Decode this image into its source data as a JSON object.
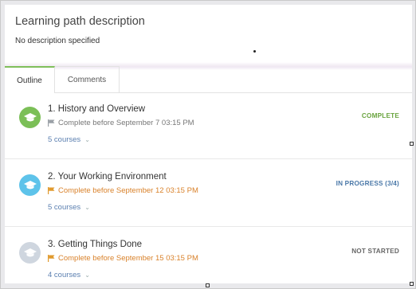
{
  "description": {
    "title": "Learning path description",
    "text": "No description specified"
  },
  "tabs": [
    {
      "label": "Outline",
      "active": true
    },
    {
      "label": "Comments",
      "active": false
    }
  ],
  "items": [
    {
      "title": "1. History and Overview",
      "due": "Complete before September 7 03:15 PM",
      "courses": "5 courses",
      "status": "COMPLETE",
      "badge_color": "#7bbf57",
      "status_color": "#6aa43f",
      "due_color": "#777777",
      "flag_color": "#9aa0a6"
    },
    {
      "title": "2. Your Working Environment",
      "due": "Complete before September 12 03:15 PM",
      "courses": "5 courses",
      "status": "IN PROGRESS (3/4)",
      "badge_color": "#5ec3ea",
      "status_color": "#4a78a8",
      "due_color": "#d9822b",
      "flag_color": "#e09a2e"
    },
    {
      "title": "3. Getting Things Done",
      "due": "Complete before September 15 03:15 PM",
      "courses": "4 courses",
      "status": "NOT STARTED",
      "badge_color": "#cfd6df",
      "status_color": "#666666",
      "due_color": "#d9822b",
      "flag_color": "#e09a2e"
    }
  ]
}
